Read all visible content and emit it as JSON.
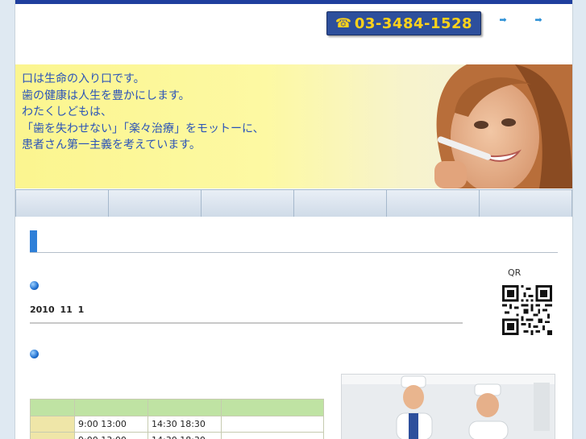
{
  "header": {
    "phone_icon": "telephone-icon",
    "phone_number": "03-3484-1528",
    "links": [
      {
        "icon": "arrow-right-icon",
        "label": ""
      },
      {
        "icon": "arrow-right-icon",
        "label": ""
      }
    ]
  },
  "hero": {
    "lines": [
      "口は生命の入り口です。",
      "歯の健康は人生を豊かにします。",
      "わたくしどもは、",
      "「歯を失わせない」「楽々治療」をモットーに、",
      "患者さん第一主義を考えています。"
    ]
  },
  "nav": {
    "items": [
      "",
      "",
      "",
      "",
      "",
      ""
    ]
  },
  "sidebar": {
    "qr_label": "QR"
  },
  "news": {
    "date": "2010 11 1"
  },
  "hours": {
    "header": [
      "",
      "",
      "",
      ""
    ],
    "rows": [
      {
        "day": "",
        "am": "9:00 13:00",
        "pm": "14:30 18:30",
        "note": ""
      },
      {
        "day": "",
        "am": "9:00 13:00",
        "pm": "14:30 18:30",
        "note": ""
      }
    ]
  },
  "colors": {
    "top_bar": "#1f3f9e",
    "phone_bg": "#2d4f9c",
    "phone_text": "#ffd21a",
    "hero_text": "#2a53b8",
    "accent": "#2e7fd8",
    "table_head": "#bfe3a3",
    "table_day": "#efe6a8"
  }
}
